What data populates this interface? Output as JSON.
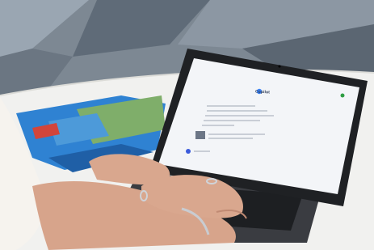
{
  "photo": {
    "scene": "hands-typing-on-laptop",
    "screen_app_title": "Copilot"
  },
  "colors": {
    "floor_dark": "#5f6b78",
    "floor_light": "#9aa6b2",
    "table": "#f2f2f0",
    "laptop_body": "#2a2c30",
    "screen": "#f3f5f8",
    "skin": "#d7a48b",
    "sleeve": "#f6f3ee",
    "map_blue": "#2b78c9",
    "book_red": "#d2453b"
  }
}
